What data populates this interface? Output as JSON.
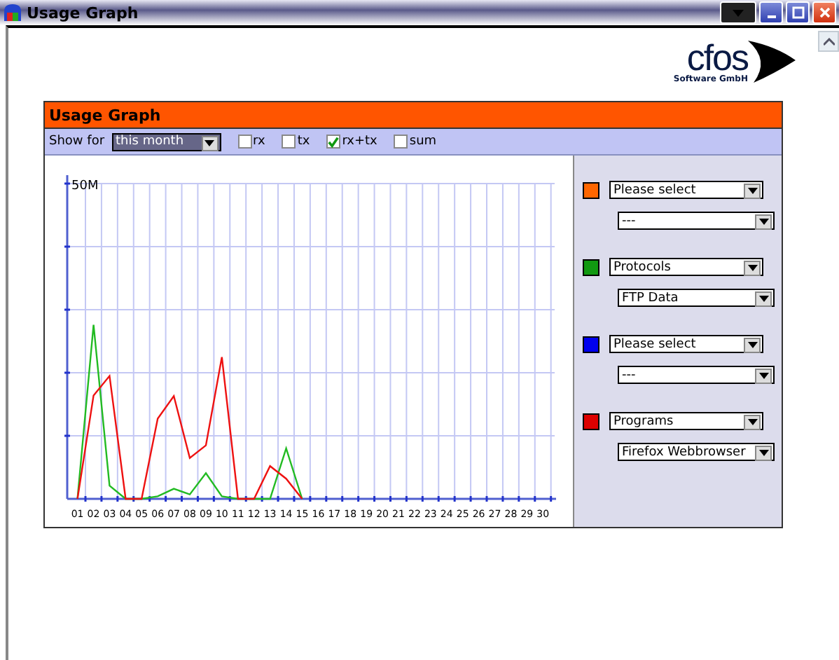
{
  "window": {
    "title": "Usage Graph"
  },
  "logo": {
    "name": "cfos",
    "subtitle": "Software GmbH"
  },
  "panel": {
    "title": "Usage Graph",
    "show_for": {
      "label": "Show for",
      "value": "this month"
    },
    "options": [
      {
        "label": "rx",
        "checked": false
      },
      {
        "label": "tx",
        "checked": false
      },
      {
        "label": "rx+tx",
        "checked": true
      },
      {
        "label": "sum",
        "checked": false
      }
    ],
    "graph": {
      "y_label": "50M",
      "x_labels": [
        "01",
        "02",
        "03",
        "04",
        "05",
        "06",
        "07",
        "08",
        "09",
        "10",
        "11",
        "12",
        "13",
        "14",
        "15",
        "16",
        "17",
        "18",
        "19",
        "20",
        "21",
        "22",
        "23",
        "24",
        "25",
        "26",
        "27",
        "28",
        "29",
        "30"
      ]
    },
    "selectors": [
      {
        "color": "#ff6600",
        "category": "Please select",
        "item": "---"
      },
      {
        "color": "#119911",
        "category": "Protocols",
        "item": "FTP Data"
      },
      {
        "color": "#0000ee",
        "category": "Please select",
        "item": "---"
      },
      {
        "color": "#dd0000",
        "category": "Programs",
        "item": "Firefox Webbrowser"
      }
    ]
  }
}
